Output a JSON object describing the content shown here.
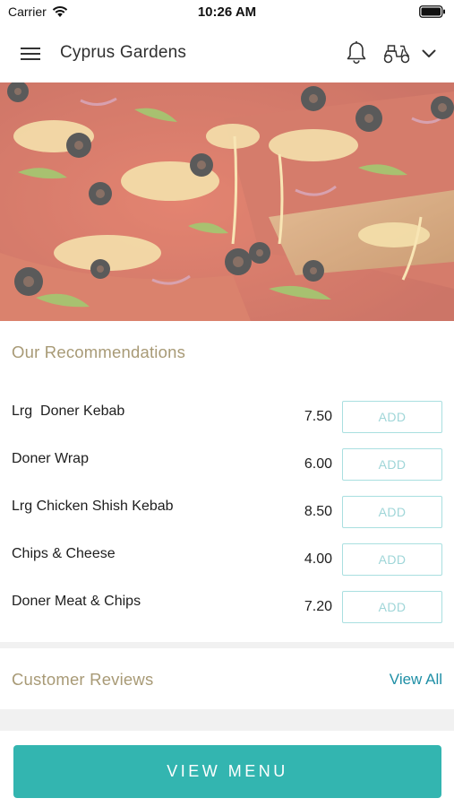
{
  "status_bar": {
    "carrier": "Carrier",
    "time": "10:26 AM"
  },
  "header": {
    "restaurant_name": "Cyprus Gardens",
    "icons": [
      "hamburger-menu-icon",
      "bell-icon",
      "scooter-delivery-icon",
      "chevron-down-icon"
    ]
  },
  "recommendations": {
    "title": "Our Recommendations",
    "items": [
      {
        "name": "Lrg  Doner Kebab",
        "price": "7.50",
        "button": "ADD"
      },
      {
        "name": "Doner Wrap",
        "price": "6.00",
        "button": "ADD"
      },
      {
        "name": "Lrg Chicken Shish Kebab",
        "price": "8.50",
        "button": "ADD"
      },
      {
        "name": "Chips & Cheese",
        "price": "4.00",
        "button": "ADD"
      },
      {
        "name": "Doner Meat & Chips",
        "price": "7.20",
        "button": "ADD"
      }
    ]
  },
  "reviews": {
    "title": "Customer Reviews",
    "view_all": "View All"
  },
  "footer": {
    "view_menu": "VIEW MENU"
  },
  "colors": {
    "accent_teal": "#33b5b0",
    "section_title_tan": "#a89a76",
    "link_blue": "#1f8fa6",
    "add_button_border": "#a9dfe0"
  }
}
